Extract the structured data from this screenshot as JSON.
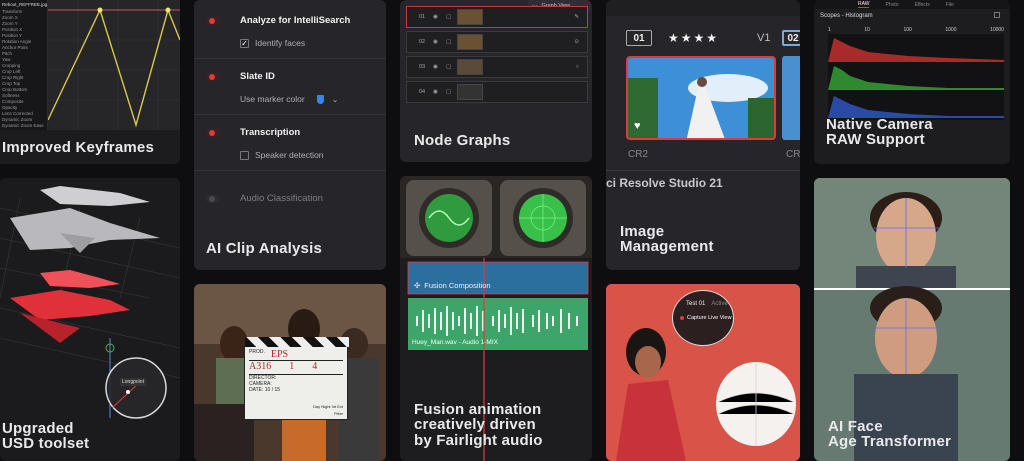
{
  "keyframes": {
    "file_label": "Reboot_REFFREE.jpg",
    "tracks": [
      "Transform",
      "Zoom X",
      "Zoom Y",
      "Position X",
      "Position Y",
      "Rotation Angle",
      "Anchor Point",
      "Pitch",
      "Yaw",
      "Cropping",
      "Crop Left",
      "Crop Right",
      "Crop Top",
      "Crop Bottom",
      "Softness",
      "Composite",
      "Opacity",
      "Lens Corrected",
      "Dynamic Zoom",
      "Dynamic Zoom Ease"
    ],
    "title": "Improved Keyframes"
  },
  "usd": {
    "title_line1": "Upgraded",
    "title_line2": "USD toolset",
    "gizmo_label": "Longpoint"
  },
  "clip": {
    "options": [
      {
        "label": "Analyze for IntelliSearch",
        "sub": "Identify faces",
        "sub_type": "checked"
      },
      {
        "label": "Slate ID",
        "sub": "Use marker color",
        "sub_type": "select"
      },
      {
        "label": "Transcription",
        "sub": "Speaker detection",
        "sub_type": "unchecked"
      },
      {
        "label": "Audio Classification",
        "sub": "",
        "sub_type": "none"
      }
    ],
    "title": "AI Clip Analysis"
  },
  "clapper": {
    "prod": "EPS",
    "roll": "A316",
    "scene": "1",
    "take": "4",
    "director_label": "DIRECTOR:",
    "camera_label": "CAMERA:",
    "date_label": "DATE: 10 / 15",
    "day_night": "Day Night Int Ext",
    "filter": "Filter"
  },
  "node": {
    "popup_label": "Graph View",
    "rows": [
      "01",
      "02",
      "03",
      "04"
    ],
    "title": "Node Graphs"
  },
  "fusion": {
    "clip_label": "Fusion Composition",
    "audio_label": "Huey_Man.wav - Audio 1-MIX",
    "title_line1": "Fusion animation",
    "title_line2": "creatively driven",
    "title_line3": "by Fairlight audio"
  },
  "image_mgmt": {
    "slot_a": "01",
    "version": "V1",
    "slot_b": "02",
    "stars": "★★★★",
    "format_a": "CR2",
    "format_b": "CR",
    "banner": "ci Resolve Studio 21",
    "title_line1": "Image",
    "title_line2": "Management"
  },
  "live": {
    "test_label": "Test 01",
    "status_label": "Active",
    "capture_label": "Capture Live View"
  },
  "raw": {
    "tabs": [
      "RAW",
      "Photo",
      "Effects",
      "File"
    ],
    "scope_label": "Scopes - Histogram",
    "scale": [
      "1",
      "10",
      "100",
      "1000",
      "10000"
    ],
    "title_line1": "Native Camera",
    "title_line2": "RAW Support"
  },
  "face": {
    "title_line1": "AI Face",
    "title_line2": "Age Transformer"
  },
  "colors": {
    "accent_red": "#e03a3a",
    "timeline_blue": "#2b6f9e",
    "audio_green": "#3ea56a"
  }
}
